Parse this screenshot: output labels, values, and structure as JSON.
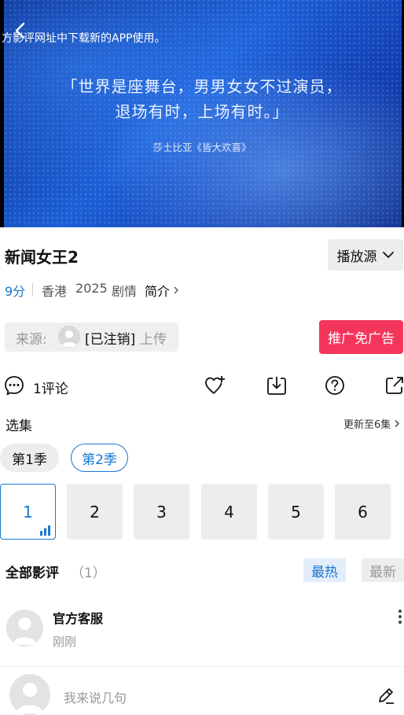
{
  "video": {
    "marquee_text": "方影评网址中下载新的APP使用。",
    "quote_line1": "「世界是座舞台，男男女女不过演员，",
    "quote_line2": "退场有时，上场有时。」",
    "quote_source": "莎士比亚《皆大欢喜》"
  },
  "show": {
    "title": "新闻女王2",
    "source_button": "播放源",
    "score": "9分",
    "region": "香港",
    "year": "2025",
    "genre": "剧情",
    "intro_link": "简介"
  },
  "uploader": {
    "label": "来源:",
    "name": "[已注销]",
    "action": "上传"
  },
  "promo_button": "推广免广告",
  "actions": {
    "comment_count": "1评论"
  },
  "episodes": {
    "section_label": "选集",
    "update_note": "更新至6集",
    "seasons": [
      "第1季",
      "第2季"
    ],
    "selected_season": "第2季",
    "list": [
      "1",
      "2",
      "3",
      "4",
      "5",
      "6"
    ],
    "playing": "1"
  },
  "reviews": {
    "title": "全部影评",
    "count": "（1）",
    "sort_hot": "最热",
    "sort_new": "最新",
    "items": [
      {
        "author": "官方客服",
        "time": "刚刚"
      }
    ]
  },
  "composer": {
    "placeholder": "我来说几句"
  },
  "colors": {
    "accent": "#1976d2",
    "promo": "#f5365c"
  }
}
